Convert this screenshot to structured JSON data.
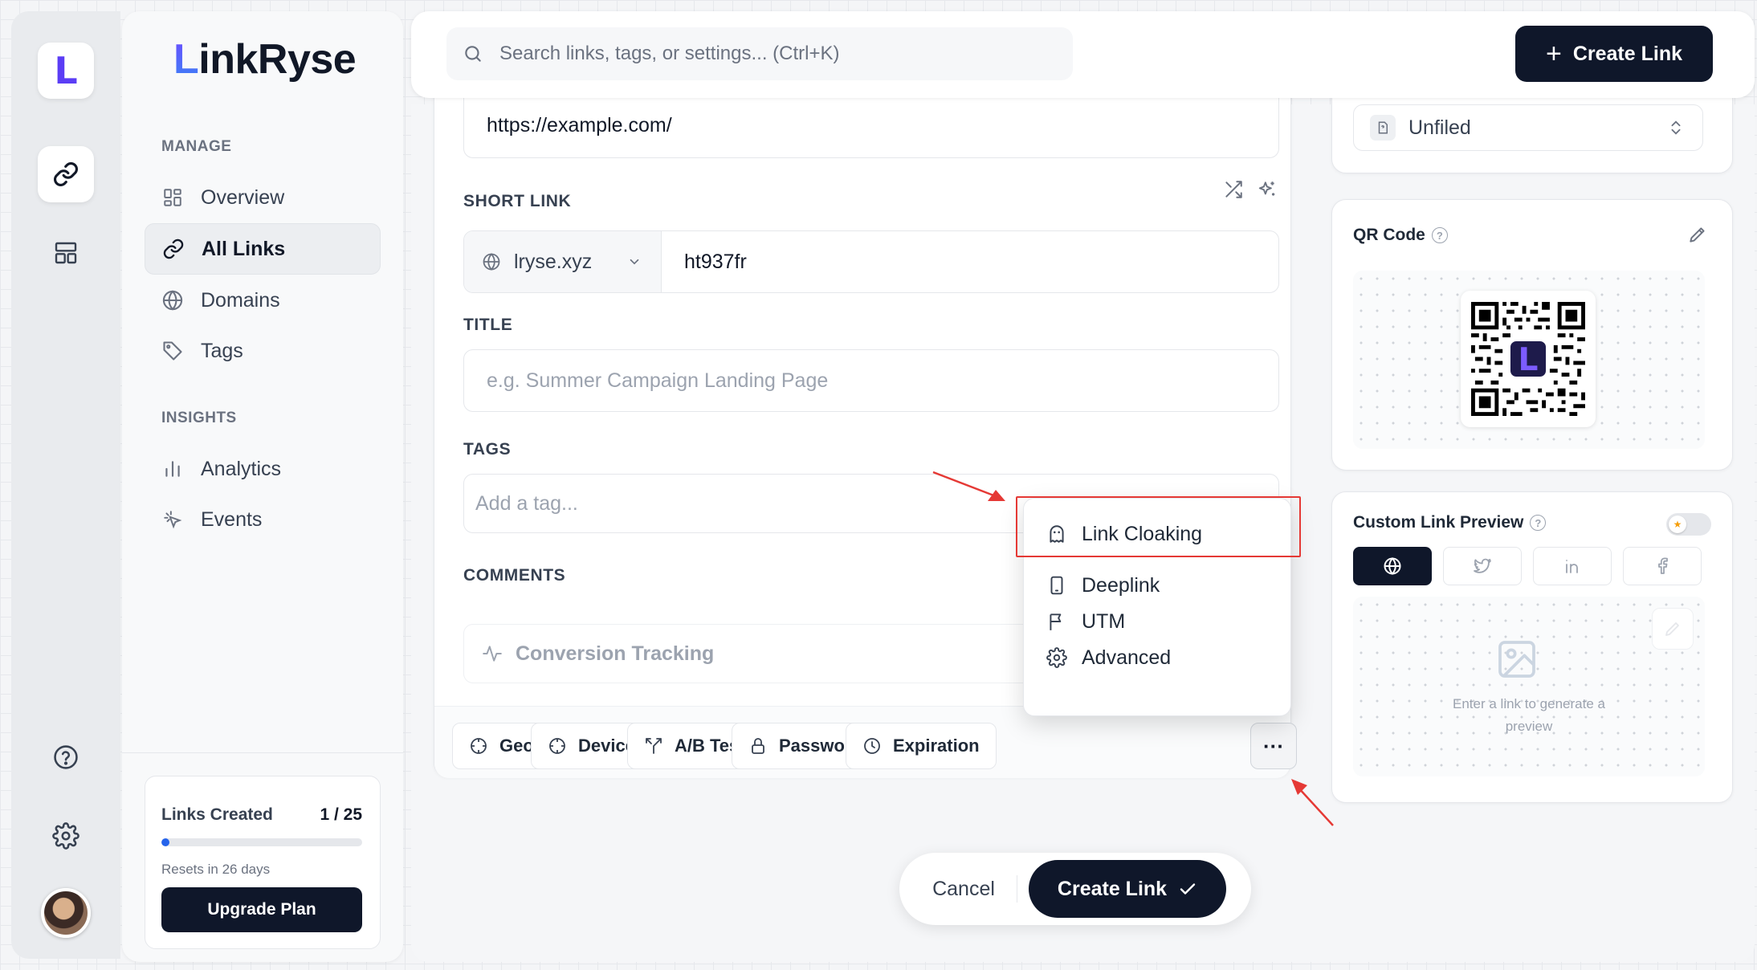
{
  "app": {
    "brand_initial": "L",
    "brand_rest": "inkRyse",
    "rail_logo": "L"
  },
  "sidebar": {
    "manage_label": "MANAGE",
    "insights_label": "INSIGHTS",
    "items": [
      {
        "label": "Overview",
        "icon": "grid-icon"
      },
      {
        "label": "All Links",
        "icon": "link-icon",
        "active": true
      },
      {
        "label": "Domains",
        "icon": "globe-icon"
      },
      {
        "label": "Tags",
        "icon": "tag-icon"
      },
      {
        "label": "Analytics",
        "icon": "bar-chart-icon"
      },
      {
        "label": "Events",
        "icon": "click-icon"
      }
    ],
    "usage": {
      "title": "Links Created",
      "count": "1 / 25",
      "progress_fraction": 0.04,
      "reset_text": "Resets in 26 days",
      "upgrade_label": "Upgrade Plan"
    }
  },
  "topbar": {
    "search_placeholder": "Search links, tags, or settings... (Ctrl+K)",
    "create_label": "Create Link"
  },
  "form": {
    "destination_value": "https://example.com/",
    "short_link_label": "SHORT LINK",
    "domain_value": "lryse.xyz",
    "slug_value": "ht937fr",
    "title_label": "TITLE",
    "title_placeholder": "e.g. Summer Campaign Landing Page",
    "tags_label": "TAGS",
    "tags_placeholder": "Add a tag...",
    "comments_label": "COMMENTS",
    "conversion_label": "Conversion Tracking",
    "options": [
      "Geo",
      "Device",
      "A/B Test",
      "Password",
      "Expiration"
    ],
    "more_label": "···"
  },
  "dropdown": {
    "items": [
      "Link Cloaking",
      "Deeplink",
      "UTM",
      "Advanced"
    ]
  },
  "actions": {
    "cancel_label": "Cancel",
    "create_label": "Create Link"
  },
  "right": {
    "folder_value": "Unfiled",
    "qr_title": "QR Code",
    "qr_logo": "L",
    "preview_title": "Custom Link Preview",
    "preview_message": "Enter a link to generate a preview"
  },
  "colors": {
    "accent": "#5b3df5",
    "primary_dark": "#0f172a",
    "highlight_red": "#e53935"
  }
}
